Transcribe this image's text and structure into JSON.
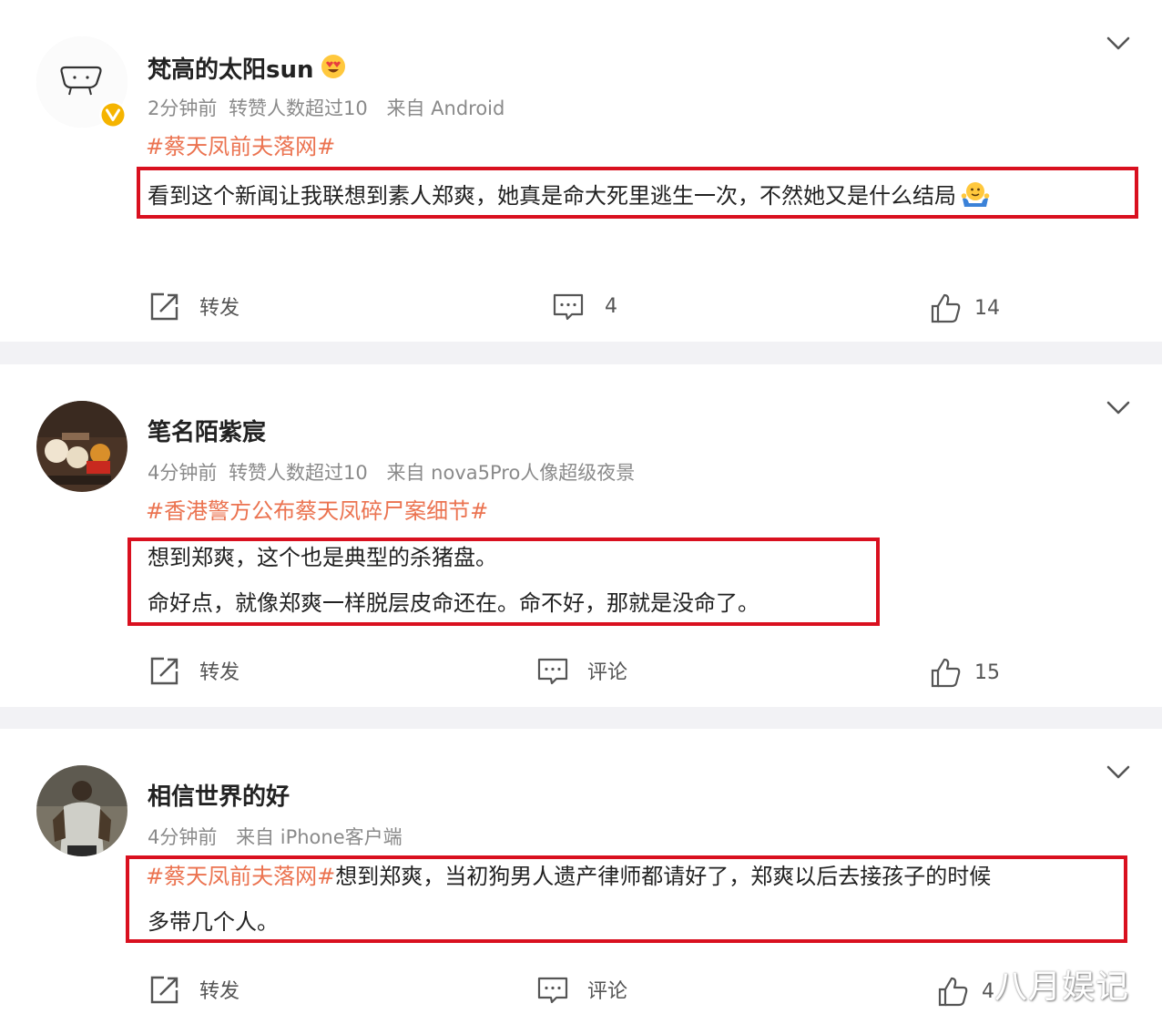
{
  "posts": [
    {
      "username": "梵高的太阳sun",
      "username_emoji": "heart-eyes-emoji",
      "verified": true,
      "meta": {
        "time": "2分钟前",
        "repost_note": "转赞人数超过10",
        "source": "来自 Android"
      },
      "topic": "#蔡天凤前夫落网#",
      "content_lines": [
        "看到这个新闻让我联想到素人郑爽，她真是命大死里逃生一次，不然她又是什么结局"
      ],
      "content_emoji": "shrug-emoji",
      "actions": {
        "repost_label": "转发",
        "comment_label": "4",
        "like_count": "14"
      }
    },
    {
      "username": "笔名陌紫宸",
      "verified": false,
      "meta": {
        "time": "4分钟前",
        "repost_note": "转赞人数超过10",
        "source": "来自 nova5Pro人像超级夜景"
      },
      "topic": "#香港警方公布蔡天凤碎尸案细节#",
      "content_lines": [
        "想到郑爽，这个也是典型的杀猪盘。",
        "命好点，就像郑爽一样脱层皮命还在。命不好，那就是没命了。"
      ],
      "actions": {
        "repost_label": "转发",
        "comment_label": "评论",
        "like_count": "15"
      }
    },
    {
      "username": "相信世界的好",
      "verified": false,
      "meta": {
        "time": "4分钟前",
        "source": "来自 iPhone客户端"
      },
      "topic_inline": "#蔡天凤前夫落网#",
      "content_lines": [
        "想到郑爽，当初狗男人遗产律师都请好了，郑爽以后去接孩子的时候",
        "多带几个人。"
      ],
      "actions": {
        "repost_label": "转发",
        "comment_label": "评论",
        "like_count": "4"
      }
    }
  ],
  "watermark": "八月娱记",
  "colors": {
    "topic": "#eb7350",
    "highlight_box": "#d9101f",
    "verified_badge": "#f5b400",
    "background": "#f2f2f5"
  }
}
